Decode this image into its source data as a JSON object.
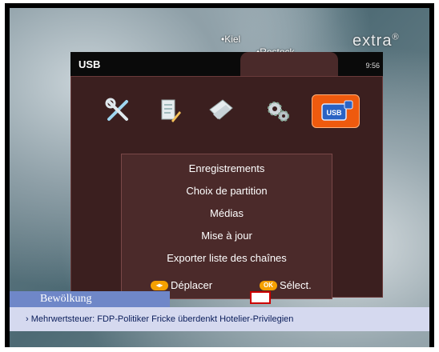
{
  "map": {
    "cities": [
      "Kiel",
      "Rostock"
    ],
    "channel_logo": "extra",
    "logo_mark": "®"
  },
  "menu": {
    "title": "USB",
    "clock": "9:56",
    "icons": [
      "tools-icon",
      "document-edit-icon",
      "envelope-icon",
      "gears-icon",
      "usb-icon"
    ],
    "usb_icon_text": "USB",
    "items": [
      "Enregistrements",
      "Choix de partition",
      "Médias",
      "Mise à jour",
      "Exporter liste des chaînes"
    ],
    "footer": {
      "move_label": "Déplacer",
      "select_label": "Sélect.",
      "ok_key": "OK"
    }
  },
  "ticker": {
    "section": "Bewölkung",
    "headline": "› Mehrwertsteuer: FDP-Politiker Fricke überdenkt Hotelier-Privilegien"
  },
  "colors": {
    "accent": "#ee5a0e",
    "menu_bg": "#3b1f1f",
    "ticker_bar": "#6f87c8"
  }
}
